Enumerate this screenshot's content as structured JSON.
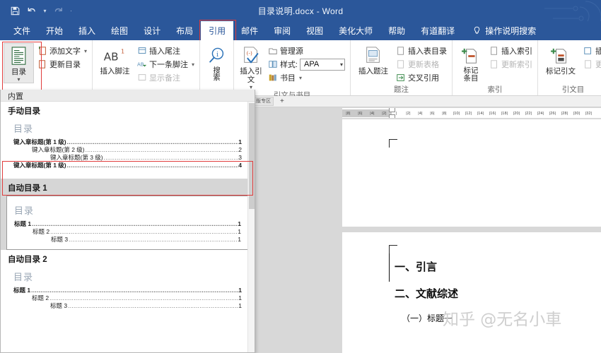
{
  "window": {
    "title": "目录说明.docx  -  Word",
    "accent_color": "#2b579a",
    "annotation_color": "#e03c3c"
  },
  "quick_access": {
    "items": [
      {
        "name": "save-button",
        "icon": "save-icon",
        "glyph": "💾",
        "enabled": true
      },
      {
        "name": "undo-button",
        "icon": "undo-icon",
        "glyph": "↶",
        "enabled": true
      },
      {
        "name": "undo-dropdown",
        "icon": "chevron-down-icon",
        "glyph": "⌄",
        "enabled": true
      },
      {
        "name": "redo-button",
        "icon": "redo-icon",
        "glyph": "↻",
        "enabled": false
      },
      {
        "name": "customize-qat-button",
        "icon": "chevron-down-icon",
        "glyph": "·",
        "enabled": true
      }
    ]
  },
  "tabs": [
    {
      "label": "文件",
      "active": false,
      "annotated": false
    },
    {
      "label": "开始",
      "active": false,
      "annotated": false
    },
    {
      "label": "插入",
      "active": false,
      "annotated": false
    },
    {
      "label": "绘图",
      "active": false,
      "annotated": false
    },
    {
      "label": "设计",
      "active": false,
      "annotated": false
    },
    {
      "label": "布局",
      "active": false,
      "annotated": false
    },
    {
      "label": "引用",
      "active": true,
      "annotated": true
    },
    {
      "label": "邮件",
      "active": false,
      "annotated": false
    },
    {
      "label": "审阅",
      "active": false,
      "annotated": false
    },
    {
      "label": "视图",
      "active": false,
      "annotated": false
    },
    {
      "label": "美化大师",
      "active": false,
      "annotated": false
    },
    {
      "label": "帮助",
      "active": false,
      "annotated": false
    },
    {
      "label": "有道翻译",
      "active": false,
      "annotated": false
    }
  ],
  "tell_me": {
    "icon": "lightbulb-icon",
    "label": "操作说明搜索"
  },
  "ribbon": {
    "groups": [
      {
        "name": "toc",
        "label": "",
        "big": {
          "label": "目录",
          "icon": "table-of-contents-icon",
          "has_caret": true,
          "selected": true,
          "annotated": true
        },
        "small": [
          {
            "label": "添加文字",
            "icon": "add-text-icon",
            "caret": true,
            "disabled": false
          },
          {
            "label": "更新目录",
            "icon": "update-toc-icon",
            "caret": false,
            "disabled": false
          }
        ]
      },
      {
        "name": "footnotes",
        "label": "",
        "big": {
          "label": "插入脚注",
          "icon": "footnote-ab-icon",
          "has_caret": false,
          "selected": false,
          "annotated": false
        },
        "small": [
          {
            "label": "插入尾注",
            "icon": "endnote-icon",
            "caret": false,
            "disabled": false
          },
          {
            "label": "下一条脚注",
            "icon": "next-footnote-icon",
            "caret": true,
            "disabled": false
          },
          {
            "label": "显示备注",
            "icon": "show-notes-icon",
            "caret": false,
            "disabled": true
          }
        ]
      },
      {
        "name": "research",
        "label": "",
        "big": {
          "label": "搜 索",
          "icon": "smart-lookup-icon",
          "has_caret": false,
          "selected": false,
          "annotated": false
        },
        "small": []
      },
      {
        "name": "citations-bibliography",
        "label": "引文与书目",
        "big": {
          "label": "插入引文",
          "icon": "insert-citation-icon",
          "has_caret": true,
          "selected": false,
          "annotated": false
        },
        "small": [
          {
            "label": "管理源",
            "icon": "manage-sources-icon",
            "caret": false,
            "disabled": false
          },
          {
            "label": "样式:",
            "icon": "style-icon",
            "caret": false,
            "disabled": false,
            "combo_value": "APA"
          },
          {
            "label": "书目",
            "icon": "bibliography-icon",
            "caret": true,
            "disabled": false
          }
        ]
      },
      {
        "name": "captions",
        "label": "题注",
        "big": {
          "label": "插入题注",
          "icon": "insert-caption-icon",
          "has_caret": false,
          "selected": false,
          "annotated": false
        },
        "small": [
          {
            "label": "插入表目录",
            "icon": "insert-table-of-figures-icon",
            "caret": false,
            "disabled": false
          },
          {
            "label": "更新表格",
            "icon": "update-table-icon",
            "caret": false,
            "disabled": true
          },
          {
            "label": "交叉引用",
            "icon": "cross-reference-icon",
            "caret": false,
            "disabled": false
          }
        ]
      },
      {
        "name": "index",
        "label": "索引",
        "big": {
          "label": "标记 条目",
          "icon": "mark-entry-icon",
          "has_caret": false,
          "selected": false,
          "annotated": false
        },
        "small": [
          {
            "label": "插入索引",
            "icon": "insert-index-icon",
            "caret": false,
            "disabled": false
          },
          {
            "label": "更新索引",
            "icon": "update-index-icon",
            "caret": false,
            "disabled": true
          }
        ]
      },
      {
        "name": "table-of-authorities",
        "label": "引文目",
        "big": {
          "label": "标记引文",
          "icon": "mark-citation-icon",
          "has_caret": false,
          "selected": false,
          "annotated": false
        },
        "small": [
          {
            "label": "插",
            "icon": "insert-table-of-authorities-icon",
            "caret": false,
            "disabled": false
          },
          {
            "label": "更",
            "icon": "update-table-icon",
            "caret": false,
            "disabled": true
          }
        ]
      }
    ]
  },
  "gallery": {
    "header": "内置",
    "scroll_visible": true,
    "items": [
      {
        "title": "手动目录",
        "selected": false,
        "annotated": false,
        "framed": false,
        "preview": {
          "heading": "目录",
          "rows": [
            {
              "label": "键入章标题(第 1 级)",
              "page": "1",
              "indent": 1,
              "bold": true
            },
            {
              "label": "键入章标题(第 2 级)",
              "page": "2",
              "indent": 2,
              "bold": false
            },
            {
              "label": "键入章标题(第 3 级)",
              "page": "3",
              "indent": 3,
              "bold": false
            },
            {
              "label": "键入章标题(第 1 级)",
              "page": "4",
              "indent": 1,
              "bold": true
            }
          ]
        }
      },
      {
        "title": "自动目录 1",
        "selected": true,
        "annotated": true,
        "framed": true,
        "preview": {
          "heading": "目录",
          "rows": [
            {
              "label": "标题 1",
              "page": "1",
              "indent": 1,
              "bold": true
            },
            {
              "label": "标题 2",
              "page": "1",
              "indent": 2,
              "bold": false
            },
            {
              "label": "标题 3",
              "page": "1",
              "indent": 3,
              "bold": false
            }
          ]
        }
      },
      {
        "title": "自动目录 2",
        "selected": false,
        "annotated": false,
        "framed": false,
        "preview": {
          "heading": "目录",
          "rows": [
            {
              "label": "标题 1",
              "page": "1",
              "indent": 1,
              "bold": true
            },
            {
              "label": "标题 2",
              "page": "1",
              "indent": 2,
              "bold": false
            },
            {
              "label": "标题 3",
              "page": "1",
              "indent": 3,
              "bold": false
            }
          ]
        }
      }
    ]
  },
  "document": {
    "sheet_tab_label": "版专区",
    "sheet_add_label": "+",
    "ruler": {
      "left_ticks": [
        "8",
        "6",
        "4",
        "2"
      ],
      "right_ticks": [
        "2",
        "4",
        "6",
        "8",
        "10",
        "12",
        "14",
        "16",
        "18",
        "20",
        "22",
        "24",
        "26",
        "28",
        "30",
        "32"
      ]
    },
    "lines": [
      {
        "text": "一、引言",
        "style": "h1"
      },
      {
        "text": "二、文献综述",
        "style": "h1"
      },
      {
        "text": "（一）标题一",
        "style": "h2"
      }
    ],
    "watermark": "知乎 @无名小車"
  }
}
